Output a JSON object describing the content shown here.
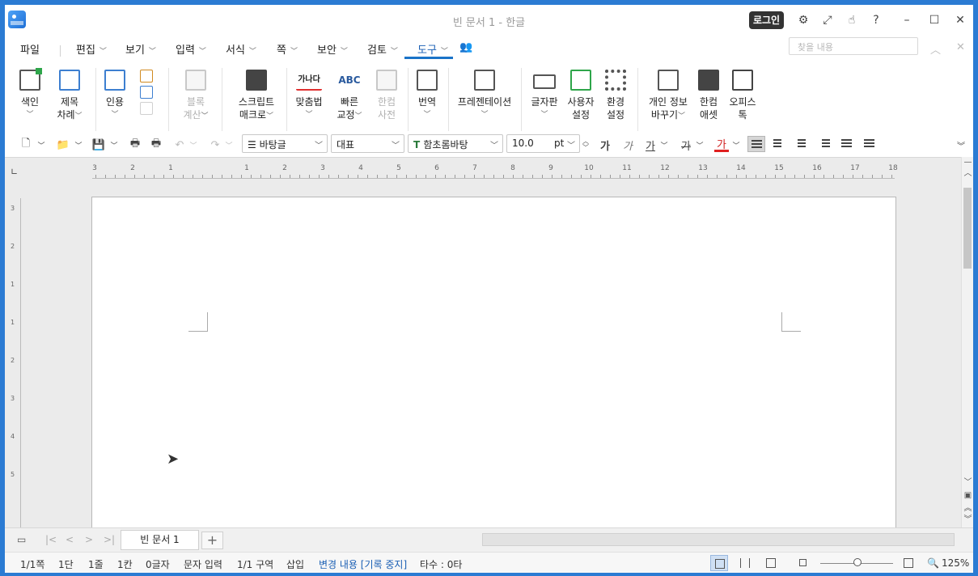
{
  "window": {
    "title": "빈 문서 1 - 한글",
    "login_label": "로그인"
  },
  "menus": [
    {
      "label": "파일",
      "chevron": false
    },
    {
      "label": "편집",
      "chevron": true
    },
    {
      "label": "보기",
      "chevron": true
    },
    {
      "label": "입력",
      "chevron": true
    },
    {
      "label": "서식",
      "chevron": true
    },
    {
      "label": "쪽",
      "chevron": true
    },
    {
      "label": "보안",
      "chevron": true
    },
    {
      "label": "검토",
      "chevron": true
    },
    {
      "label": "도구",
      "chevron": true,
      "active": true
    }
  ],
  "find_placeholder": "찾을 내용",
  "ribbon": [
    {
      "line1": "색인",
      "line2": "",
      "icon": "index-icon"
    },
    {
      "line1": "제목",
      "line2": "차례",
      "icon": "toc-icon"
    },
    {
      "line1": "인용",
      "line2": "",
      "icon": "citation-icon"
    },
    {
      "line1": "블록",
      "line2": "계산",
      "icon": "block-calc-icon",
      "disabled": true
    },
    {
      "line1": "스크립트",
      "line2": "매크로",
      "icon": "script-macro-icon"
    },
    {
      "line1": "맞춤법",
      "line2": "",
      "icon": "spellcheck-icon",
      "glyph": "가나다"
    },
    {
      "line1": "빠른",
      "line2": "교정",
      "icon": "quick-correct-icon",
      "glyph": "ABC"
    },
    {
      "line1": "한컴",
      "line2": "사전",
      "icon": "dictionary-icon",
      "disabled": true
    },
    {
      "line1": "번역",
      "line2": "",
      "icon": "translate-icon"
    },
    {
      "line1": "프레젠테이션",
      "line2": "",
      "icon": "presentation-icon"
    },
    {
      "line1": "글자판",
      "line2": "",
      "icon": "keyboard-icon"
    },
    {
      "line1": "사용자",
      "line2": "설정",
      "icon": "user-settings-icon"
    },
    {
      "line1": "환경",
      "line2": "설정",
      "icon": "preferences-icon"
    },
    {
      "line1": "개인 정보",
      "line2": "바꾸기",
      "icon": "privacy-icon"
    },
    {
      "line1": "한컴",
      "line2": "애셋",
      "icon": "asset-icon"
    },
    {
      "line1": "오피스",
      "line2": "톡",
      "icon": "office-talk-icon"
    }
  ],
  "format": {
    "style": "바탕글",
    "language": "대표",
    "font": "함초롬바탕",
    "size": "10.0",
    "unit": "pt",
    "bold_glyph": "가",
    "italic_glyph": "가",
    "underline_glyph": "가",
    "strike_glyph": "가",
    "color_glyph": "가"
  },
  "ruler_numbers": [
    "3",
    "2",
    "1",
    "1",
    "2",
    "3",
    "4",
    "5",
    "6",
    "7",
    "8",
    "9",
    "10",
    "11",
    "12",
    "13",
    "14",
    "15",
    "16",
    "17",
    "18"
  ],
  "vruler_numbers": [
    "3",
    "2",
    "1",
    "1",
    "2",
    "3",
    "4",
    "5"
  ],
  "tabs": {
    "doc_tab": "빈 문서 1",
    "add": "+"
  },
  "status": {
    "page": "1/1쪽",
    "column": "1단",
    "line": "1줄",
    "cell": "1칸",
    "chars": "0글자",
    "input_mode": "문자 입력",
    "section": "1/1 구역",
    "insert": "삽입",
    "track_changes": "변경 내용 [기록 중지]",
    "keystrokes": "타수 : 0타",
    "zoom": "125%"
  }
}
